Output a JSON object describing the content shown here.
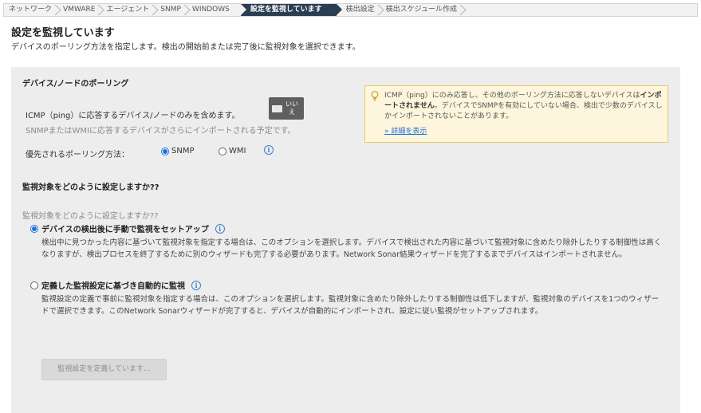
{
  "breadcrumb": [
    {
      "label": "ネットワーク",
      "active": false
    },
    {
      "label": "VMWARE",
      "active": false
    },
    {
      "label": "エージェント",
      "active": false
    },
    {
      "label": "SNMP",
      "active": false
    },
    {
      "label": "WINDOWS",
      "active": false
    },
    {
      "label": "設定を監視しています",
      "active": true
    },
    {
      "label": "検出設定",
      "active": false
    },
    {
      "label": "検出スケジュール作成",
      "active": false
    }
  ],
  "header": {
    "title": "設定を監視しています",
    "description": "デバイスのポーリング方法を指定します。検出の開始前または完了後に監視対象を選択できます。"
  },
  "polling": {
    "title": "デバイス/ノードのポーリング",
    "icmp_label": "ICMP（ping）に応答するデバイス/ノードのみを含めます。",
    "toggle_label": "いいえ",
    "toggle_state": "off",
    "snmp_note": "SNMPまたはWMIに応答するデバイスがさらにインポートされる予定です。",
    "method_label": "優先されるポーリング方法：",
    "options": [
      {
        "label": "SNMP",
        "selected": true
      },
      {
        "label": "WMI",
        "selected": false
      }
    ],
    "info_icon": "info-icon"
  },
  "warning": {
    "icon": "lightbulb-icon",
    "text_before": "ICMP（ping）にのみ応答し、その他のポーリング方法に応答しないデバイスは",
    "text_bold": "インポートされません",
    "text_after": "。デバイスでSNMPを有効にしていない場合、検出で少数のデバイスしかインポートされないことがあります。",
    "link": "» 詳細を表示"
  },
  "monitoring": {
    "heading": "監視対象をどのように設定しますか??",
    "subheading": "監視対象をどのように設定しますか??",
    "options": [
      {
        "label": "デバイスの検出後に手動で監視をセットアップ",
        "selected": true,
        "description": "検出中に見つかった内容に基づいて監視対象を指定する場合は、このオプションを選択します。デバイスで検出された内容に基づいて監視対象に含めたり除外したりする制御性は高くなりますが、検出プロセスを終了するために別のウィザードも完了する必要があります。Network Sonar結果ウィザードを完了するまでデバイスはインポートされません。"
      },
      {
        "label": "定義した監視設定に基づき自動的に監視",
        "selected": false,
        "description": "監視設定の定義で事前に監視対象を指定する場合は、このオプションを選択します。監視対象に含めたり除外したりする制御性は低下しますが、監視対象のデバイスを1つのウィザードで選択できます。このNetwork Sonarウィザードが完了すると、デバイスが自動的にインポートされ、設定に従い監視がセットアップされます。"
      }
    ],
    "define_button": "監視設定を定義しています..."
  },
  "colors": {
    "active_crumb": "#2a3e52",
    "panel_bg": "#ededed",
    "warning_bg": "#fdf6dc",
    "link": "#1e6fd9"
  }
}
